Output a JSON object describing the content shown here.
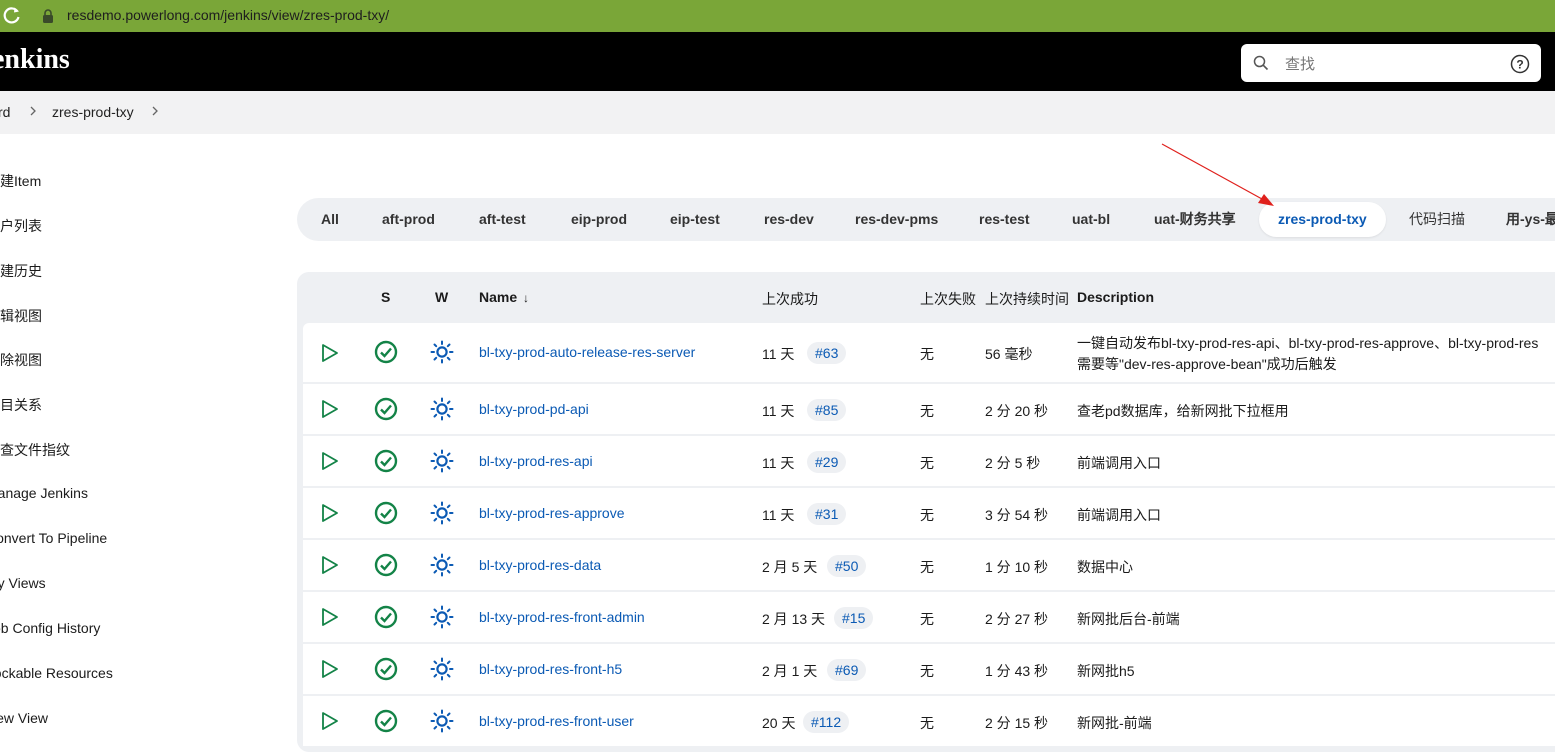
{
  "browser": {
    "url": "resdemo.powerlong.com/jenkins/view/zres-prod-txy/"
  },
  "header": {
    "logo": "Jenkins",
    "logo_visible": "enkins"
  },
  "search": {
    "placeholder": "查找"
  },
  "breadcrumb": {
    "items": [
      "rd",
      "zres-prod-txy"
    ]
  },
  "sidebar": {
    "items": [
      {
        "label": "新建Item",
        "visible": "新建Item"
      },
      {
        "label": "用户列表",
        "visible": "用户列表"
      },
      {
        "label": "构建历史",
        "visible": "构建历史"
      },
      {
        "label": "编辑视图",
        "visible": "编辑视图"
      },
      {
        "label": "删除视图",
        "visible": "删除视图"
      },
      {
        "label": "项目关系",
        "visible": "项目关系"
      },
      {
        "label": "检查文件指纹",
        "visible": "检查文件指纹"
      },
      {
        "label": "Manage Jenkins",
        "visible": "Manage Jenkins"
      },
      {
        "label": "Convert To Pipeline",
        "visible": "Convert To Pipeline"
      },
      {
        "label": "My Views",
        "visible": "My Views"
      },
      {
        "label": "Job Config History",
        "visible": "Job Config History"
      },
      {
        "label": "Lockable Resources",
        "visible": "Lockable Resources"
      },
      {
        "label": "New View",
        "visible": "New View"
      }
    ]
  },
  "tabs": [
    {
      "label": "All"
    },
    {
      "label": "aft-prod"
    },
    {
      "label": "aft-test"
    },
    {
      "label": "eip-prod"
    },
    {
      "label": "eip-test"
    },
    {
      "label": "res-dev"
    },
    {
      "label": "res-dev-pms"
    },
    {
      "label": "res-test"
    },
    {
      "label": "uat-bl"
    },
    {
      "label": "uat-财务共享"
    },
    {
      "label": "zres-prod-txy",
      "active": true
    },
    {
      "label": "代码扫描"
    },
    {
      "label": "用-ys-最"
    }
  ],
  "table": {
    "headers": {
      "s": "S",
      "w": "W",
      "name": "Name",
      "sort_indicator": "↓",
      "last_success": "上次成功",
      "last_failure": "上次失败",
      "last_duration": "上次持续时间",
      "description": "Description"
    },
    "rows": [
      {
        "name": "bl-txy-prod-auto-release-res-server",
        "last_success": "11 天",
        "build": "#63",
        "last_failure": "无",
        "duration": "56 毫秒",
        "description": "一键自动发布bl-txy-prod-res-api、bl-txy-prod-res-approve、bl-txy-prod-res",
        "description2": "需要等\"dev-res-approve-bean\"成功后触发"
      },
      {
        "name": "bl-txy-prod-pd-api",
        "last_success": "11 天",
        "build": "#85",
        "last_failure": "无",
        "duration": "2 分 20 秒",
        "description": "查老pd数据库，给新网批下拉框用"
      },
      {
        "name": "bl-txy-prod-res-api",
        "last_success": "11 天",
        "build": "#29",
        "last_failure": "无",
        "duration": "2 分 5 秒",
        "description": "前端调用入口"
      },
      {
        "name": "bl-txy-prod-res-approve",
        "last_success": "11 天",
        "build": "#31",
        "last_failure": "无",
        "duration": "3 分 54 秒",
        "description": "前端调用入口"
      },
      {
        "name": "bl-txy-prod-res-data",
        "last_success": "2 月 5 天",
        "build": "#50",
        "last_failure": "无",
        "duration": "1 分 10 秒",
        "description": "数据中心"
      },
      {
        "name": "bl-txy-prod-res-front-admin",
        "last_success": "2 月 13 天",
        "build": "#15",
        "last_failure": "无",
        "duration": "2 分 27 秒",
        "description": "新网批后台-前端"
      },
      {
        "name": "bl-txy-prod-res-front-h5",
        "last_success": "2 月 1 天",
        "build": "#69",
        "last_failure": "无",
        "duration": "1 分 43 秒",
        "description": "新网批h5"
      },
      {
        "name": "bl-txy-prod-res-front-user",
        "last_success": "20 天",
        "build": "#112",
        "last_failure": "无",
        "duration": "2 分 15 秒",
        "description": "新网批-前端"
      }
    ]
  },
  "colors": {
    "success": "#138347",
    "link": "#0b5ab4",
    "annotation_arrow": "#e0201c",
    "address_bar": "#7aa638"
  }
}
